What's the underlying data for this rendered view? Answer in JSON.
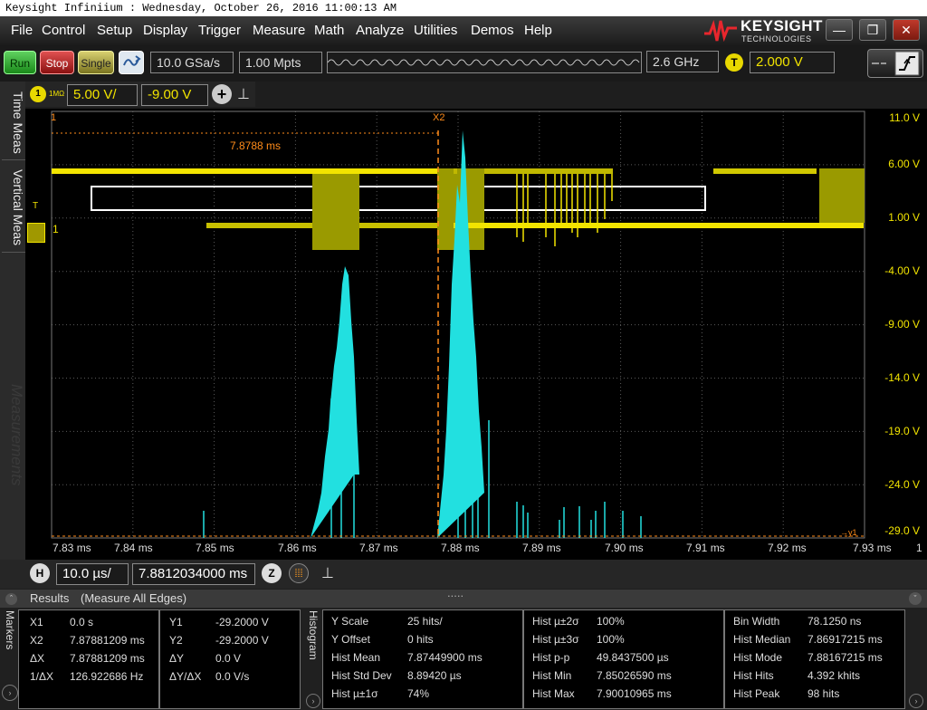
{
  "title_bar": {
    "text": "Keysight Infiniium : Wednesday, October 26, 2016 11:00:13 AM"
  },
  "menu": [
    "File",
    "Control",
    "Setup",
    "Display",
    "Trigger",
    "Measure",
    "Math",
    "Analyze",
    "Utilities",
    "Demos",
    "Help"
  ],
  "logo": {
    "name": "KEYSIGHT",
    "sub": "TECHNOLOGIES"
  },
  "window_buttons": {
    "minimize": "—",
    "restore": "❐",
    "close": "✕"
  },
  "toolbar": {
    "run": "Run",
    "stop": "Stop",
    "single": "Single",
    "sample_rate": "10.0 GSa/s",
    "memory_depth": "1.00 Mpts",
    "bandwidth": "2.6 GHz",
    "trigger_badge": "T",
    "trigger_level": "2.000 V"
  },
  "channel": {
    "num": "1",
    "impedance": "1MΩ",
    "scale": "5.00 V/",
    "offset": "-9.00 V",
    "add": "+",
    "pin": "⊥"
  },
  "left_tabs": {
    "time_meas": "Time Meas",
    "vertical_meas": "Vertical Meas",
    "measurements": "Measurements",
    "expand": "»"
  },
  "cursors": {
    "x1": "1",
    "x2": "X2",
    "delta": "7.8788 ms",
    "trigger_marker": "T",
    "ch_marker": "1",
    "y_marker": "→y1",
    "right_ch": "1"
  },
  "y_axis": [
    "11.0 V",
    "6.00 V",
    "1.00 V",
    "-4.00 V",
    "-9.00 V",
    "-14.0 V",
    "-19.0 V",
    "-24.0 V",
    "-29.0 V"
  ],
  "x_axis": [
    "7.83 ms",
    "7.84 ms",
    "7.85 ms",
    "7.86 ms",
    "7.87 ms",
    "7.88 ms",
    "7.89 ms",
    "7.90 ms",
    "7.91 ms",
    "7.92 ms",
    "7.93 ms"
  ],
  "horizontal": {
    "badge": "H",
    "scale": "10.0 µs/",
    "position": "7.8812034000 ms",
    "zoom": "Z"
  },
  "results_header": {
    "title": "Results",
    "subtitle": "(Measure All Edges)",
    "grip": "....."
  },
  "side_labels": {
    "markers": "Markers",
    "histogram": "Histogram"
  },
  "markers": [
    {
      "label": "X1",
      "value": "0.0 s"
    },
    {
      "label": "X2",
      "value": "7.87881209 ms"
    },
    {
      "label": "ΔX",
      "value": "7.87881209 ms"
    },
    {
      "label": "1/ΔX",
      "value": "126.922686 Hz"
    }
  ],
  "markers_y": [
    {
      "label": "Y1",
      "value": "-29.2000 V"
    },
    {
      "label": "Y2",
      "value": "-29.2000 V"
    },
    {
      "label": "ΔY",
      "value": "0.0 V"
    },
    {
      "label": "ΔY/ΔX",
      "value": "0.0 V/s"
    }
  ],
  "histogram": [
    [
      {
        "label": "Y Scale",
        "value": "25 hits/"
      },
      {
        "label": "Y Offset",
        "value": "0 hits"
      },
      {
        "label": "Hist Mean",
        "value": "7.87449900 ms"
      },
      {
        "label": "Hist Std Dev",
        "value": "8.89420 µs"
      },
      {
        "label": "Hist µ±1σ",
        "value": "74%"
      }
    ],
    [
      {
        "label": "Hist µ±2σ",
        "value": "100%"
      },
      {
        "label": "Hist µ±3σ",
        "value": "100%"
      },
      {
        "label": "Hist p-p",
        "value": "49.8437500 µs"
      },
      {
        "label": "Hist Min",
        "value": "7.85026590 ms"
      },
      {
        "label": "Hist Max",
        "value": "7.90010965 ms"
      }
    ],
    [
      {
        "label": "Bin Width",
        "value": "78.1250 ns"
      },
      {
        "label": "Hist Median",
        "value": "7.86917215 ms"
      },
      {
        "label": "Hist Mode",
        "value": "7.88167215 ms"
      },
      {
        "label": "Hist Hits",
        "value": "4.392 khits"
      },
      {
        "label": "Hist Peak",
        "value": "98 hits"
      }
    ]
  ],
  "colors": {
    "trace": "#f2e400",
    "histogram": "#22e0e0",
    "cursor": "#ff8c1a",
    "grid": "#5a5a5a"
  }
}
